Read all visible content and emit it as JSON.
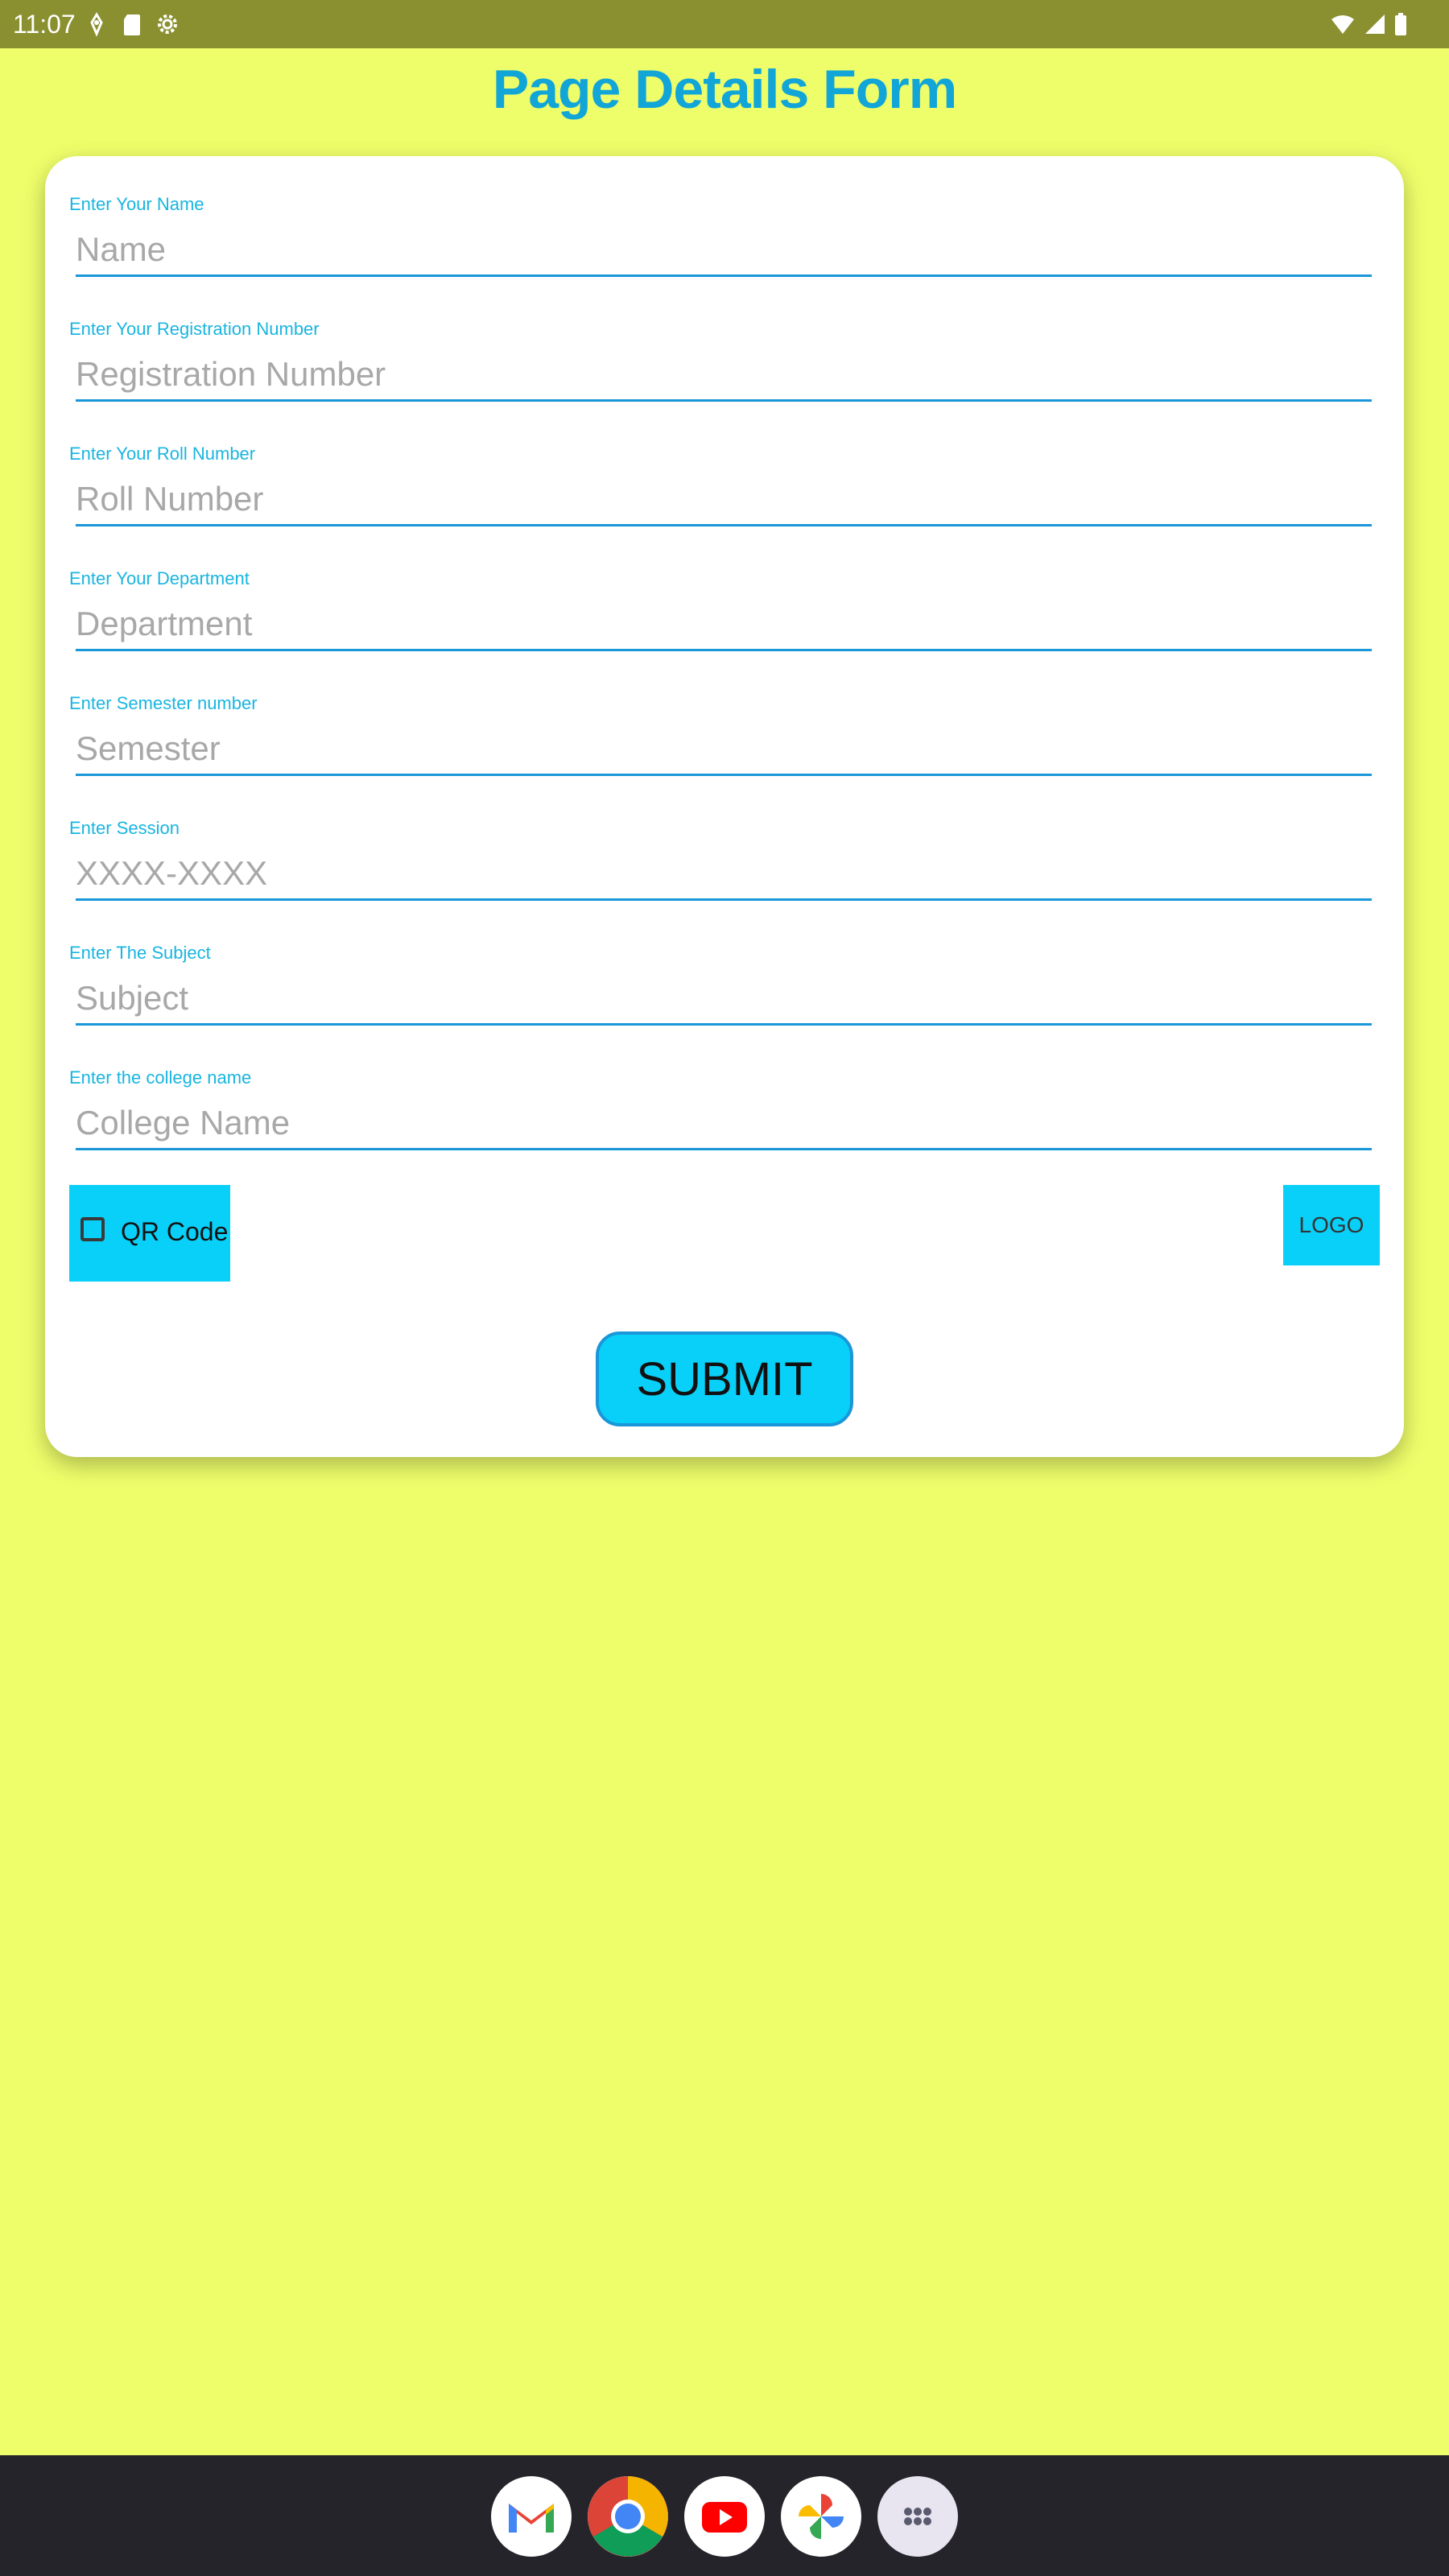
{
  "status_bar": {
    "time": "11:07",
    "left_icons": [
      "location-icon",
      "sd-card-icon",
      "settings-gear-icon"
    ],
    "right_icons": [
      "wifi-icon",
      "cellular-signal-icon",
      "battery-icon"
    ]
  },
  "header": {
    "title": "Page Details Form",
    "title_color": "#11a5d8"
  },
  "form": {
    "fields": [
      {
        "label": "Enter Your Name",
        "placeholder": "Name",
        "value": ""
      },
      {
        "label": "Enter Your Registration Number",
        "placeholder": "Registration Number",
        "value": ""
      },
      {
        "label": "Enter Your Roll Number",
        "placeholder": "Roll Number",
        "value": ""
      },
      {
        "label": "Enter Your Department",
        "placeholder": "Department",
        "value": ""
      },
      {
        "label": "Enter Semester number",
        "placeholder": "Semester",
        "value": ""
      },
      {
        "label": "Enter Session",
        "placeholder": "XXXX-XXXX",
        "value": ""
      },
      {
        "label": "Enter The Subject",
        "placeholder": "Subject",
        "value": ""
      },
      {
        "label": "Enter the college name",
        "placeholder": "College Name",
        "value": ""
      }
    ],
    "qr_checkbox_label": "QR Code",
    "qr_checked": false,
    "logo_button_label": "LOGO",
    "submit_label": "SUBMIT",
    "accent_color": "#09d0f8"
  },
  "nav_bar": {
    "dock_apps": [
      "gmail-icon",
      "chrome-icon",
      "youtube-icon",
      "photos-icon",
      "app-drawer-icon"
    ]
  },
  "colors": {
    "background": "#eefe6a",
    "status_bar": "#8a9030",
    "card": "#ffffff",
    "underline": "#1a97d8",
    "label": "#19b5e0",
    "nav_bar": "#24242a"
  }
}
